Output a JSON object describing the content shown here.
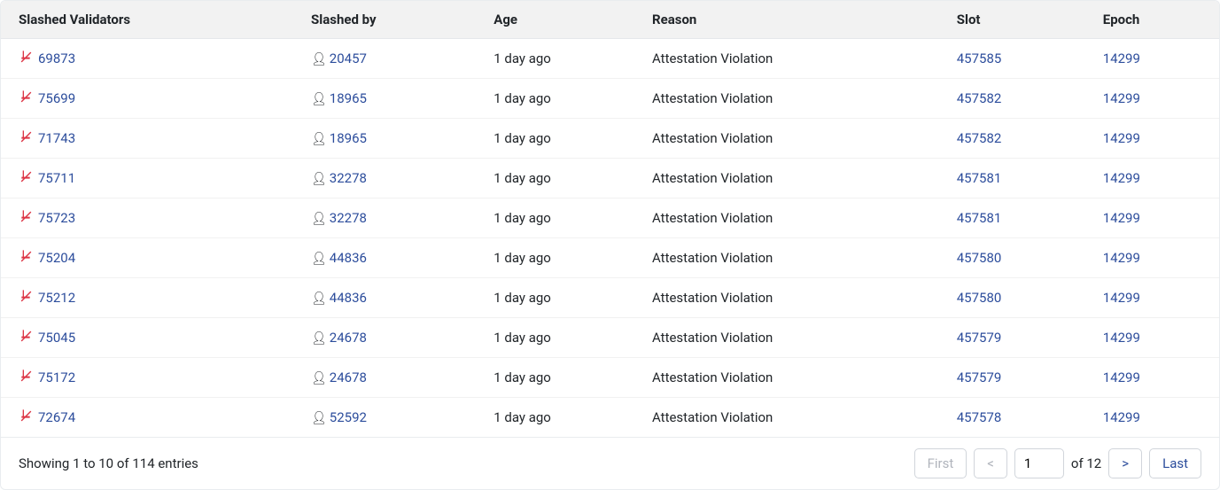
{
  "headers": {
    "validator": "Slashed Validators",
    "slashedby": "Slashed by",
    "age": "Age",
    "reason": "Reason",
    "slot": "Slot",
    "epoch": "Epoch"
  },
  "rows": [
    {
      "validator": "69873",
      "slashedby": "20457",
      "age": "1 day ago",
      "reason": "Attestation Violation",
      "slot": "457585",
      "epoch": "14299"
    },
    {
      "validator": "75699",
      "slashedby": "18965",
      "age": "1 day ago",
      "reason": "Attestation Violation",
      "slot": "457582",
      "epoch": "14299"
    },
    {
      "validator": "71743",
      "slashedby": "18965",
      "age": "1 day ago",
      "reason": "Attestation Violation",
      "slot": "457582",
      "epoch": "14299"
    },
    {
      "validator": "75711",
      "slashedby": "32278",
      "age": "1 day ago",
      "reason": "Attestation Violation",
      "slot": "457581",
      "epoch": "14299"
    },
    {
      "validator": "75723",
      "slashedby": "32278",
      "age": "1 day ago",
      "reason": "Attestation Violation",
      "slot": "457581",
      "epoch": "14299"
    },
    {
      "validator": "75204",
      "slashedby": "44836",
      "age": "1 day ago",
      "reason": "Attestation Violation",
      "slot": "457580",
      "epoch": "14299"
    },
    {
      "validator": "75212",
      "slashedby": "44836",
      "age": "1 day ago",
      "reason": "Attestation Violation",
      "slot": "457580",
      "epoch": "14299"
    },
    {
      "validator": "75045",
      "slashedby": "24678",
      "age": "1 day ago",
      "reason": "Attestation Violation",
      "slot": "457579",
      "epoch": "14299"
    },
    {
      "validator": "75172",
      "slashedby": "24678",
      "age": "1 day ago",
      "reason": "Attestation Violation",
      "slot": "457579",
      "epoch": "14299"
    },
    {
      "validator": "72674",
      "slashedby": "52592",
      "age": "1 day ago",
      "reason": "Attestation Violation",
      "slot": "457578",
      "epoch": "14299"
    }
  ],
  "footer": {
    "showing": "Showing 1 to 10 of 114 entries",
    "first": "First",
    "prev": "<",
    "page": "1",
    "of": "of 12",
    "next": ">",
    "last": "Last"
  }
}
